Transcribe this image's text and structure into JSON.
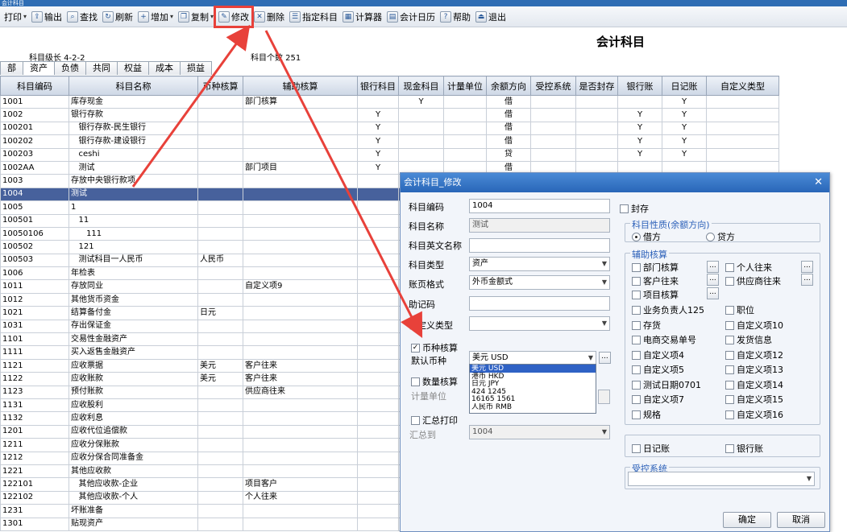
{
  "window": {
    "title": "会计科目"
  },
  "toolbar": [
    {
      "label": "打印",
      "icon": "printer-icon",
      "dropdown": true
    },
    {
      "label": "输出",
      "icon": "export-icon"
    },
    {
      "label": "查找",
      "icon": "search-icon"
    },
    {
      "label": "刷新",
      "icon": "refresh-icon"
    },
    {
      "label": "增加",
      "icon": "add-icon",
      "dropdown": true
    },
    {
      "label": "复制",
      "icon": "copy-icon",
      "dropdown": true
    },
    {
      "label": "修改",
      "icon": "edit-icon",
      "highlighted": true
    },
    {
      "label": "删除",
      "icon": "delete-icon"
    },
    {
      "label": "指定科目",
      "icon": "assign-icon"
    },
    {
      "label": "计算器",
      "icon": "calculator-icon"
    },
    {
      "label": "会计日历",
      "icon": "calendar-icon"
    },
    {
      "label": "帮助",
      "icon": "help-icon"
    },
    {
      "label": "退出",
      "icon": "exit-icon"
    }
  ],
  "page": {
    "title": "会计科目",
    "level": "科目级长  4-2-2",
    "count": "科目个数 251"
  },
  "tabs": [
    "部",
    "资产",
    "负债",
    "共同",
    "权益",
    "成本",
    "损益"
  ],
  "grid": {
    "columns": [
      "科目编码",
      "科目名称",
      "币种核算",
      "辅助核算",
      "银行科目",
      "现金科目",
      "计量单位",
      "余额方向",
      "受控系统",
      "是否封存",
      "银行账",
      "日记账",
      "自定义类型"
    ],
    "rows": [
      [
        "1001",
        "库存现金",
        "",
        "部门核算",
        "",
        "Y",
        "",
        "借",
        "",
        "",
        "",
        "Y",
        ""
      ],
      [
        "1002",
        "银行存款",
        "",
        "",
        "Y",
        "",
        "",
        "借",
        "",
        "",
        "Y",
        "Y",
        ""
      ],
      [
        "100201",
        "   银行存款-民生银行",
        "",
        "",
        "Y",
        "",
        "",
        "借",
        "",
        "",
        "Y",
        "Y",
        ""
      ],
      [
        "100202",
        "   银行存款-建设银行",
        "",
        "",
        "Y",
        "",
        "",
        "借",
        "",
        "",
        "Y",
        "Y",
        ""
      ],
      [
        "100203",
        "   ceshi",
        "",
        "",
        "Y",
        "",
        "",
        "贷",
        "",
        "",
        "Y",
        "Y",
        ""
      ],
      [
        "1002AA",
        "   测试",
        "",
        "部门项目",
        "Y",
        "",
        "",
        "借",
        "",
        "",
        "",
        "",
        ""
      ],
      [
        "1003",
        "存放中央银行款项",
        "",
        "",
        "",
        "",
        "",
        "",
        "",
        "",
        "",
        "",
        ""
      ],
      [
        "1004",
        "测试",
        "",
        "",
        "",
        "",
        "",
        "",
        "",
        "",
        "",
        "",
        ""
      ],
      [
        "1005",
        "1",
        "",
        "",
        "",
        "",
        "",
        "",
        "",
        "",
        "",
        "",
        ""
      ],
      [
        "100501",
        "   11",
        "",
        "",
        "",
        "",
        "",
        "",
        "",
        "",
        "",
        "",
        ""
      ],
      [
        "10050106",
        "      111",
        "",
        "",
        "",
        "",
        "",
        "",
        "",
        "",
        "",
        "",
        ""
      ],
      [
        "100502",
        "   121",
        "",
        "",
        "",
        "",
        "",
        "",
        "",
        "",
        "",
        "",
        ""
      ],
      [
        "100503",
        "   测试科目一人民币",
        "人民币",
        "",
        "",
        "",
        "",
        "",
        "",
        "",
        "",
        "",
        ""
      ],
      [
        "1006",
        "年检表",
        "",
        "",
        "",
        "",
        "",
        "",
        "",
        "",
        "",
        "",
        ""
      ],
      [
        "1011",
        "存放同业",
        "",
        "自定义项9",
        "",
        "",
        "",
        "",
        "",
        "",
        "",
        "",
        ""
      ],
      [
        "1012",
        "其他货币资金",
        "",
        "",
        "",
        "",
        "",
        "",
        "",
        "",
        "",
        "",
        ""
      ],
      [
        "1021",
        "结算备付金",
        "日元",
        "",
        "",
        "",
        "",
        "",
        "",
        "",
        "",
        "",
        ""
      ],
      [
        "1031",
        "存出保证金",
        "",
        "",
        "",
        "",
        "",
        "",
        "",
        "",
        "",
        "",
        ""
      ],
      [
        "1101",
        "交易性金融资产",
        "",
        "",
        "",
        "",
        "",
        "",
        "",
        "",
        "",
        "",
        ""
      ],
      [
        "1111",
        "买入返售金融资产",
        "",
        "",
        "",
        "",
        "",
        "",
        "",
        "",
        "",
        "",
        ""
      ],
      [
        "1121",
        "应收票据",
        "美元",
        "客户往来",
        "",
        "",
        "",
        "",
        "",
        "",
        "",
        "",
        ""
      ],
      [
        "1122",
        "应收账款",
        "美元",
        "客户往来",
        "",
        "",
        "",
        "",
        "",
        "",
        "",
        "",
        ""
      ],
      [
        "1123",
        "预付账款",
        "",
        "供应商往来",
        "",
        "",
        "",
        "",
        "",
        "",
        "",
        "",
        ""
      ],
      [
        "1131",
        "应收股利",
        "",
        "",
        "",
        "",
        "",
        "",
        "",
        "",
        "",
        "",
        ""
      ],
      [
        "1132",
        "应收利息",
        "",
        "",
        "",
        "",
        "",
        "",
        "",
        "",
        "",
        "",
        ""
      ],
      [
        "1201",
        "应收代位追偿款",
        "",
        "",
        "",
        "",
        "",
        "",
        "",
        "",
        "",
        "",
        ""
      ],
      [
        "1211",
        "应收分保账款",
        "",
        "",
        "",
        "",
        "",
        "",
        "",
        "",
        "",
        "",
        ""
      ],
      [
        "1212",
        "应收分保合同准备金",
        "",
        "",
        "",
        "",
        "",
        "",
        "",
        "",
        "",
        "",
        ""
      ],
      [
        "1221",
        "其他应收款",
        "",
        "",
        "",
        "",
        "",
        "",
        "",
        "",
        "",
        "",
        ""
      ],
      [
        "122101",
        "   其他应收款-企业",
        "",
        "项目客户",
        "",
        "",
        "",
        "",
        "",
        "",
        "",
        "",
        ""
      ],
      [
        "122102",
        "   其他应收款-个人",
        "",
        "个人往来",
        "",
        "",
        "",
        "",
        "",
        "",
        "",
        "",
        ""
      ],
      [
        "1231",
        "坏账准备",
        "",
        "",
        "",
        "",
        "",
        "",
        "",
        "",
        "",
        "",
        ""
      ],
      [
        "1301",
        "贴现资产",
        "",
        "",
        "",
        "",
        "",
        "",
        "",
        "",
        "",
        "",
        ""
      ]
    ],
    "selected_row": 7
  },
  "dialog": {
    "title": "会计科目_修改",
    "code_label": "科目编码",
    "code_value": "1004",
    "name_label": "科目名称",
    "name_value": "测试",
    "en_label": "科目英文名称",
    "en_value": "",
    "type_label": "科目类型",
    "type_value": "资产",
    "format_label": "账页格式",
    "format_value": "外币金额式",
    "mnemonic_label": "助记码",
    "mnemonic_value": "",
    "custom_type_label": "自定义类型",
    "custom_type_value": "",
    "currency_check_label": "币种核算",
    "currency_checked": true,
    "default_currency_label": "默认币种",
    "default_currency_value": "美元 USD",
    "currency_options": [
      "美元 USD",
      "港币 HKD",
      "日元 JPY",
      "424 1245",
      "16165 1561",
      "人民币 RMB"
    ],
    "quantity_check_label": "数量核算",
    "unit_label": "计量单位",
    "summary_print_label": "汇总打印",
    "summary_to_label": "汇总到",
    "summary_to_value": "1004",
    "sealed_label": "封存",
    "nature_group": "科目性质(余额方向)",
    "debit_label": "借方",
    "credit_label": "贷方",
    "nature_value": "借方",
    "aux_group": "辅助核算",
    "aux_items": [
      "部门核算",
      "个人往来",
      "客户往来",
      "供应商往来",
      "项目核算",
      "业务负责人125",
      "职位",
      "存货",
      "自定义项10",
      "电商交易单号",
      "发货信息",
      "自定义项4",
      "自定义项12",
      "自定义项5",
      "自定义项13",
      "测试日期0701",
      "自定义项14",
      "自定义项7",
      "自定义项15",
      "规格",
      "自定义项16"
    ],
    "journal_label": "日记账",
    "bank_label": "银行账",
    "controlled_group": "受控系统",
    "controlled_value": "",
    "ok_label": "确定",
    "cancel_label": "取消"
  }
}
